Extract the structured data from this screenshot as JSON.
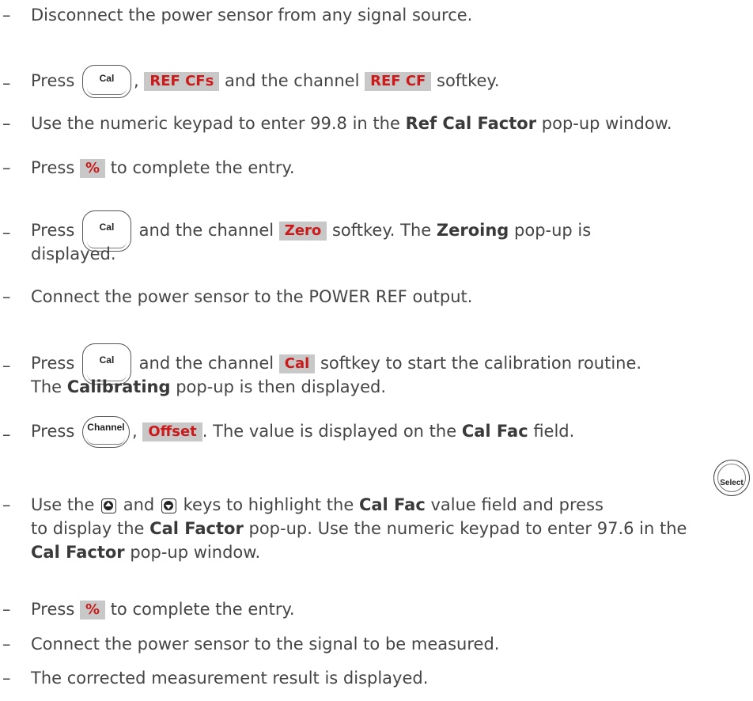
{
  "dash": "–",
  "steps": {
    "s1": {
      "text": "Disconnect the power sensor from any signal source."
    },
    "s2": {
      "press": "Press",
      "key": "Cal",
      "comma": ",",
      "sk1": "REF CFs",
      "mid": "and the channel",
      "sk2": "REF CF",
      "end": "softkey."
    },
    "s3": {
      "a": "Use the numeric keypad to enter 99.8 in the",
      "b": "Ref Cal Factor",
      "c": "pop-up window."
    },
    "s4": {
      "press": "Press",
      "sk": "%",
      "end": "to complete the entry."
    },
    "s5": {
      "press": "Press",
      "key": "Cal",
      "mid": "and the channel",
      "sk": "Zero",
      "a": "softkey. The",
      "b": "Zeroing",
      "c": "pop-up is",
      "line2": "displayed."
    },
    "s6": {
      "text": "Connect the power sensor to the POWER REF output."
    },
    "s7": {
      "press": "Press",
      "key": "Cal",
      "mid": "and the channel",
      "sk": "Cal",
      "a": "softkey to start the calibration routine.",
      "l2a": "The",
      "l2b": "Calibrating",
      "l2c": "pop-up is then displayed."
    },
    "s8": {
      "press": "Press",
      "key": "Channel",
      "comma": ",",
      "sk": "Offset",
      "a": ". The value is displayed on the",
      "b": "Cal Fac",
      "c": "field."
    },
    "s9": {
      "a": "Use the",
      "and": "and",
      "b": "keys to highlight the",
      "c": "Cal Fac",
      "d": "value field and press",
      "key": "Select",
      "l2a": "to display the",
      "l2b": "Cal Factor",
      "l2c": "pop-up. Use the numeric keypad to enter 97.6 in the",
      "l3a": "Cal Factor",
      "l3b": "pop-up window."
    },
    "s10": {
      "press": "Press",
      "sk": "%",
      "end": "to complete the entry."
    },
    "s11": {
      "text": "Connect the power sensor to the signal to be measured."
    },
    "s12": {
      "text": "The corrected measurement result is displayed."
    }
  }
}
